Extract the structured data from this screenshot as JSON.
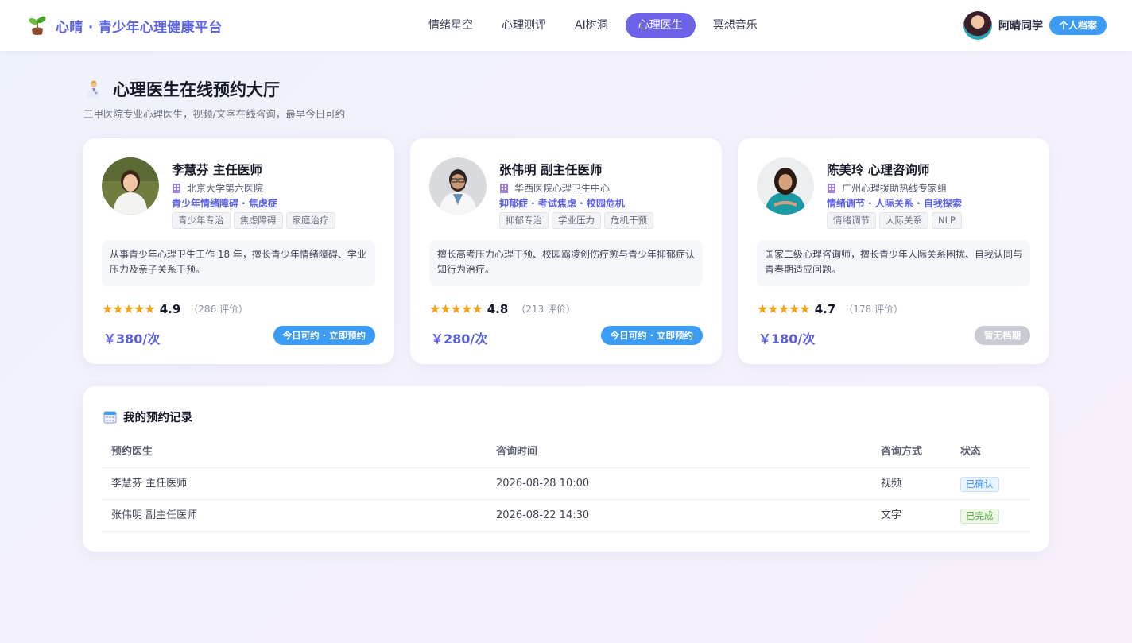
{
  "header": {
    "brand": "心晴 · 青少年心理健康平台",
    "nav": [
      "情绪星空",
      "心理测评",
      "AI树洞",
      "心理医生",
      "冥想音乐"
    ],
    "active_nav": "心理医生",
    "user_name": "阿晴同学",
    "profile_button": "个人档案"
  },
  "page": {
    "title": "心理医生在线预约大厅",
    "subtitle": "三甲医院专业心理医生，视频/文字在线咨询，最早今日可约"
  },
  "doctors": [
    {
      "name": "李慧芬 主任医师",
      "hospital": "北京大学第六医院",
      "specialty": "青少年情绪障碍 · 焦虑症",
      "tags": [
        "青少年专治",
        "焦虑障碍",
        "家庭治疗"
      ],
      "description": "从事青少年心理卫生工作 18 年，擅长青少年情绪障碍、学业压力及亲子关系干预。",
      "stars": "★★★★★",
      "rating": "4.9",
      "reviews": "（286 评价）",
      "price": "￥380/次",
      "button": "今日可约 · 立即预约",
      "available": true
    },
    {
      "name": "张伟明 副主任医师",
      "hospital": "华西医院心理卫生中心",
      "specialty": "抑郁症 · 考试焦虑 · 校园危机",
      "tags": [
        "抑郁专治",
        "学业压力",
        "危机干预"
      ],
      "description": "擅长高考压力心理干预、校园霸凌创伤疗愈与青少年抑郁症认知行为治疗。",
      "stars": "★★★★★",
      "rating": "4.8",
      "reviews": "（213 评价）",
      "price": "￥280/次",
      "button": "今日可约 · 立即预约",
      "available": true
    },
    {
      "name": "陈美玲 心理咨询师",
      "hospital": "广州心理援助热线专家组",
      "specialty": "情绪调节 · 人际关系 · 自我探索",
      "tags": [
        "情绪调节",
        "人际关系",
        "NLP"
      ],
      "description": "国家二级心理咨询师，擅长青少年人际关系困扰、自我认同与青春期适应问题。",
      "stars": "★★★★★",
      "rating": "4.7",
      "reviews": "（178 评价）",
      "price": "￥180/次",
      "button": "暂无档期",
      "available": false
    }
  ],
  "records": {
    "title": "我的预约记录",
    "columns": [
      "预约医生",
      "咨询时间",
      "咨询方式",
      "状态"
    ],
    "rows": [
      {
        "doctor": "李慧芬 主任医师",
        "time": "2026-08-28 10:00",
        "mode": "视频",
        "status": "已确认",
        "status_color": "#3b8fe8"
      },
      {
        "doctor": "张伟明 副主任医师",
        "time": "2026-08-22 14:30",
        "mode": "文字",
        "status": "已完成",
        "status_color": "#52a83a"
      }
    ]
  },
  "colors": {
    "accent": "#6c63e8",
    "brand": "#5b63e0",
    "button_blue": "#3b9bf5",
    "star": "#f0a31d"
  }
}
